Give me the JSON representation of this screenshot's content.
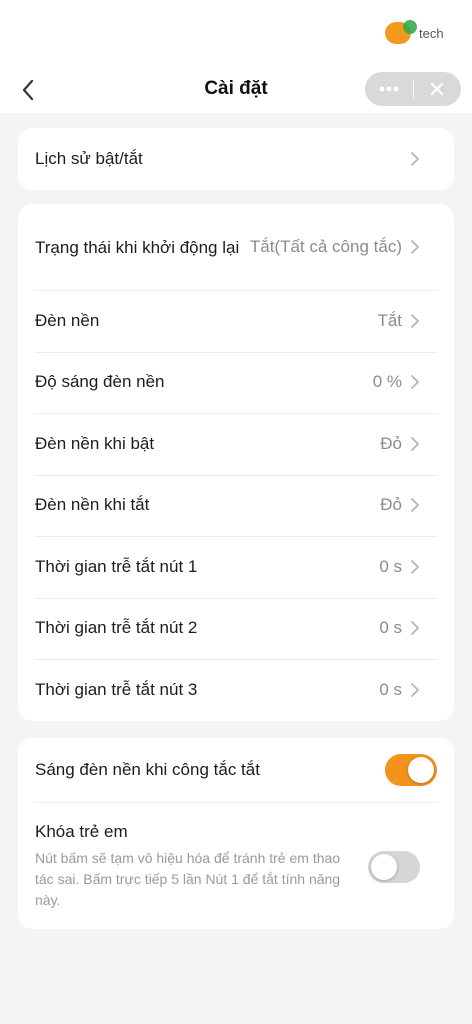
{
  "watermark": {
    "logo": "ĐH",
    "text": "tech"
  },
  "header": {
    "title": "Cài đặt",
    "more_label": "•••",
    "close_label": "✕"
  },
  "colors": {
    "accent": "#f3921d",
    "toggle_off": "#d6d6d9",
    "background": "#f4f4f6"
  },
  "card1": {
    "history_label": "Lịch sử bật/tắt"
  },
  "card2": {
    "items": [
      {
        "label": "Trạng thái khi khởi động lại",
        "value": "Tắt(Tất cả công tắc)"
      },
      {
        "label": "Đèn nền",
        "value": "Tắt"
      },
      {
        "label": "Độ sáng đèn nền",
        "value": "0 %"
      },
      {
        "label": "Đèn nền khi bật",
        "value": "Đỏ"
      },
      {
        "label": "Đèn nền khi tắt",
        "value": "Đỏ"
      },
      {
        "label": "Thời gian trễ tắt nút 1",
        "value": "0 s"
      },
      {
        "label": "Thời gian trễ tắt nút 2",
        "value": "0 s"
      },
      {
        "label": "Thời gian trễ tắt nút 3",
        "value": "0 s"
      }
    ]
  },
  "card3": {
    "backlight_off_label": "Sáng đèn nền khi công tắc tắt",
    "backlight_off_enabled": true,
    "child_lock_label": "Khóa trẻ em",
    "child_lock_desc": "Nút bấm sẽ tạm vô hiệu hóa để tránh trẻ em thao tác sai. Bấm trực tiếp 5 lần Nút 1 để tắt tính năng này.",
    "child_lock_enabled": false
  },
  "icons": {
    "back": "chevron-left-icon",
    "row": "chevron-right-icon"
  }
}
